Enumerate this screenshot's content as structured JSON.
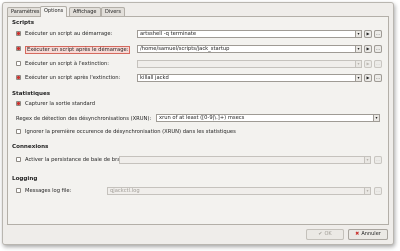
{
  "tabs": [
    "Paramètres",
    "Options",
    "Affichage",
    "Divers"
  ],
  "sections": {
    "scripts": "Scripts",
    "statistiques": "Statistiques",
    "connexions": "Connexions",
    "logging": "Logging"
  },
  "scripts": {
    "rows": [
      {
        "label": "Exécuter un script au démarrage:",
        "value": "artsshell -q terminate",
        "checked": true
      },
      {
        "label": "Exécuter un script après le démarrage:",
        "value": "/home/samuel/scripts/jack_startup",
        "checked": true
      },
      {
        "label": "Exécuter un script à l'extinction:",
        "value": "",
        "checked": false
      },
      {
        "label": "Exécuter un script après l'extinction:",
        "value": "killall jackd",
        "checked": true
      }
    ],
    "browse_label": "...",
    "arrow_label": "▶"
  },
  "statistiques": {
    "capture_label": "Capturer la sortie standard",
    "regex_label": "Regex de détection des désynchronisations (XRUN):",
    "regex_value": "xrun of at least ([0-9|\\.]+) msecs",
    "ignore_label": "Ignorer la première occurence de désynchronisation (XRUN) dans les statistiques"
  },
  "connexions": {
    "persist_label": "Activer la persistance de baie de brassage:",
    "persist_value": ""
  },
  "logging": {
    "messages_label": "Messages log file:",
    "messages_value": "qjackctl.log"
  },
  "footer": {
    "ok_label": "OK",
    "cancel_label": "Annuler"
  }
}
